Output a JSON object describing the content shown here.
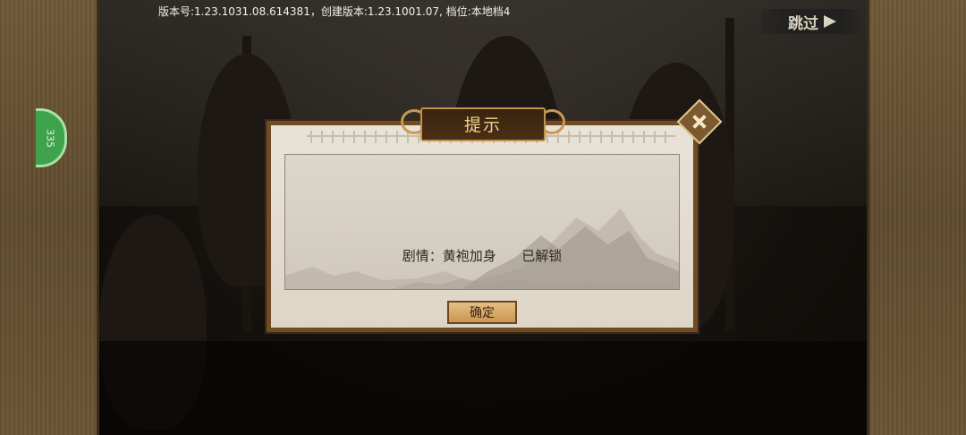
{
  "version_info": "版本号:1.23.1031.08.614381，创建版本:1.23.1001.07, 档位:本地档4",
  "skip_button": {
    "label": "跳过",
    "icon": "arrow-right-icon"
  },
  "side_tab": {
    "label": "335"
  },
  "dialog": {
    "title": "提示",
    "message": "剧情：黄袍加身      已解锁",
    "confirm_label": "确定",
    "close_icon": "close-icon"
  },
  "colors": {
    "dialog_frame": "#6f4b26",
    "dialog_paper": "#e9e3d7",
    "title_text": "#f0d58f",
    "confirm_button": "#d9a866",
    "side_tab": "#3ea34b"
  }
}
